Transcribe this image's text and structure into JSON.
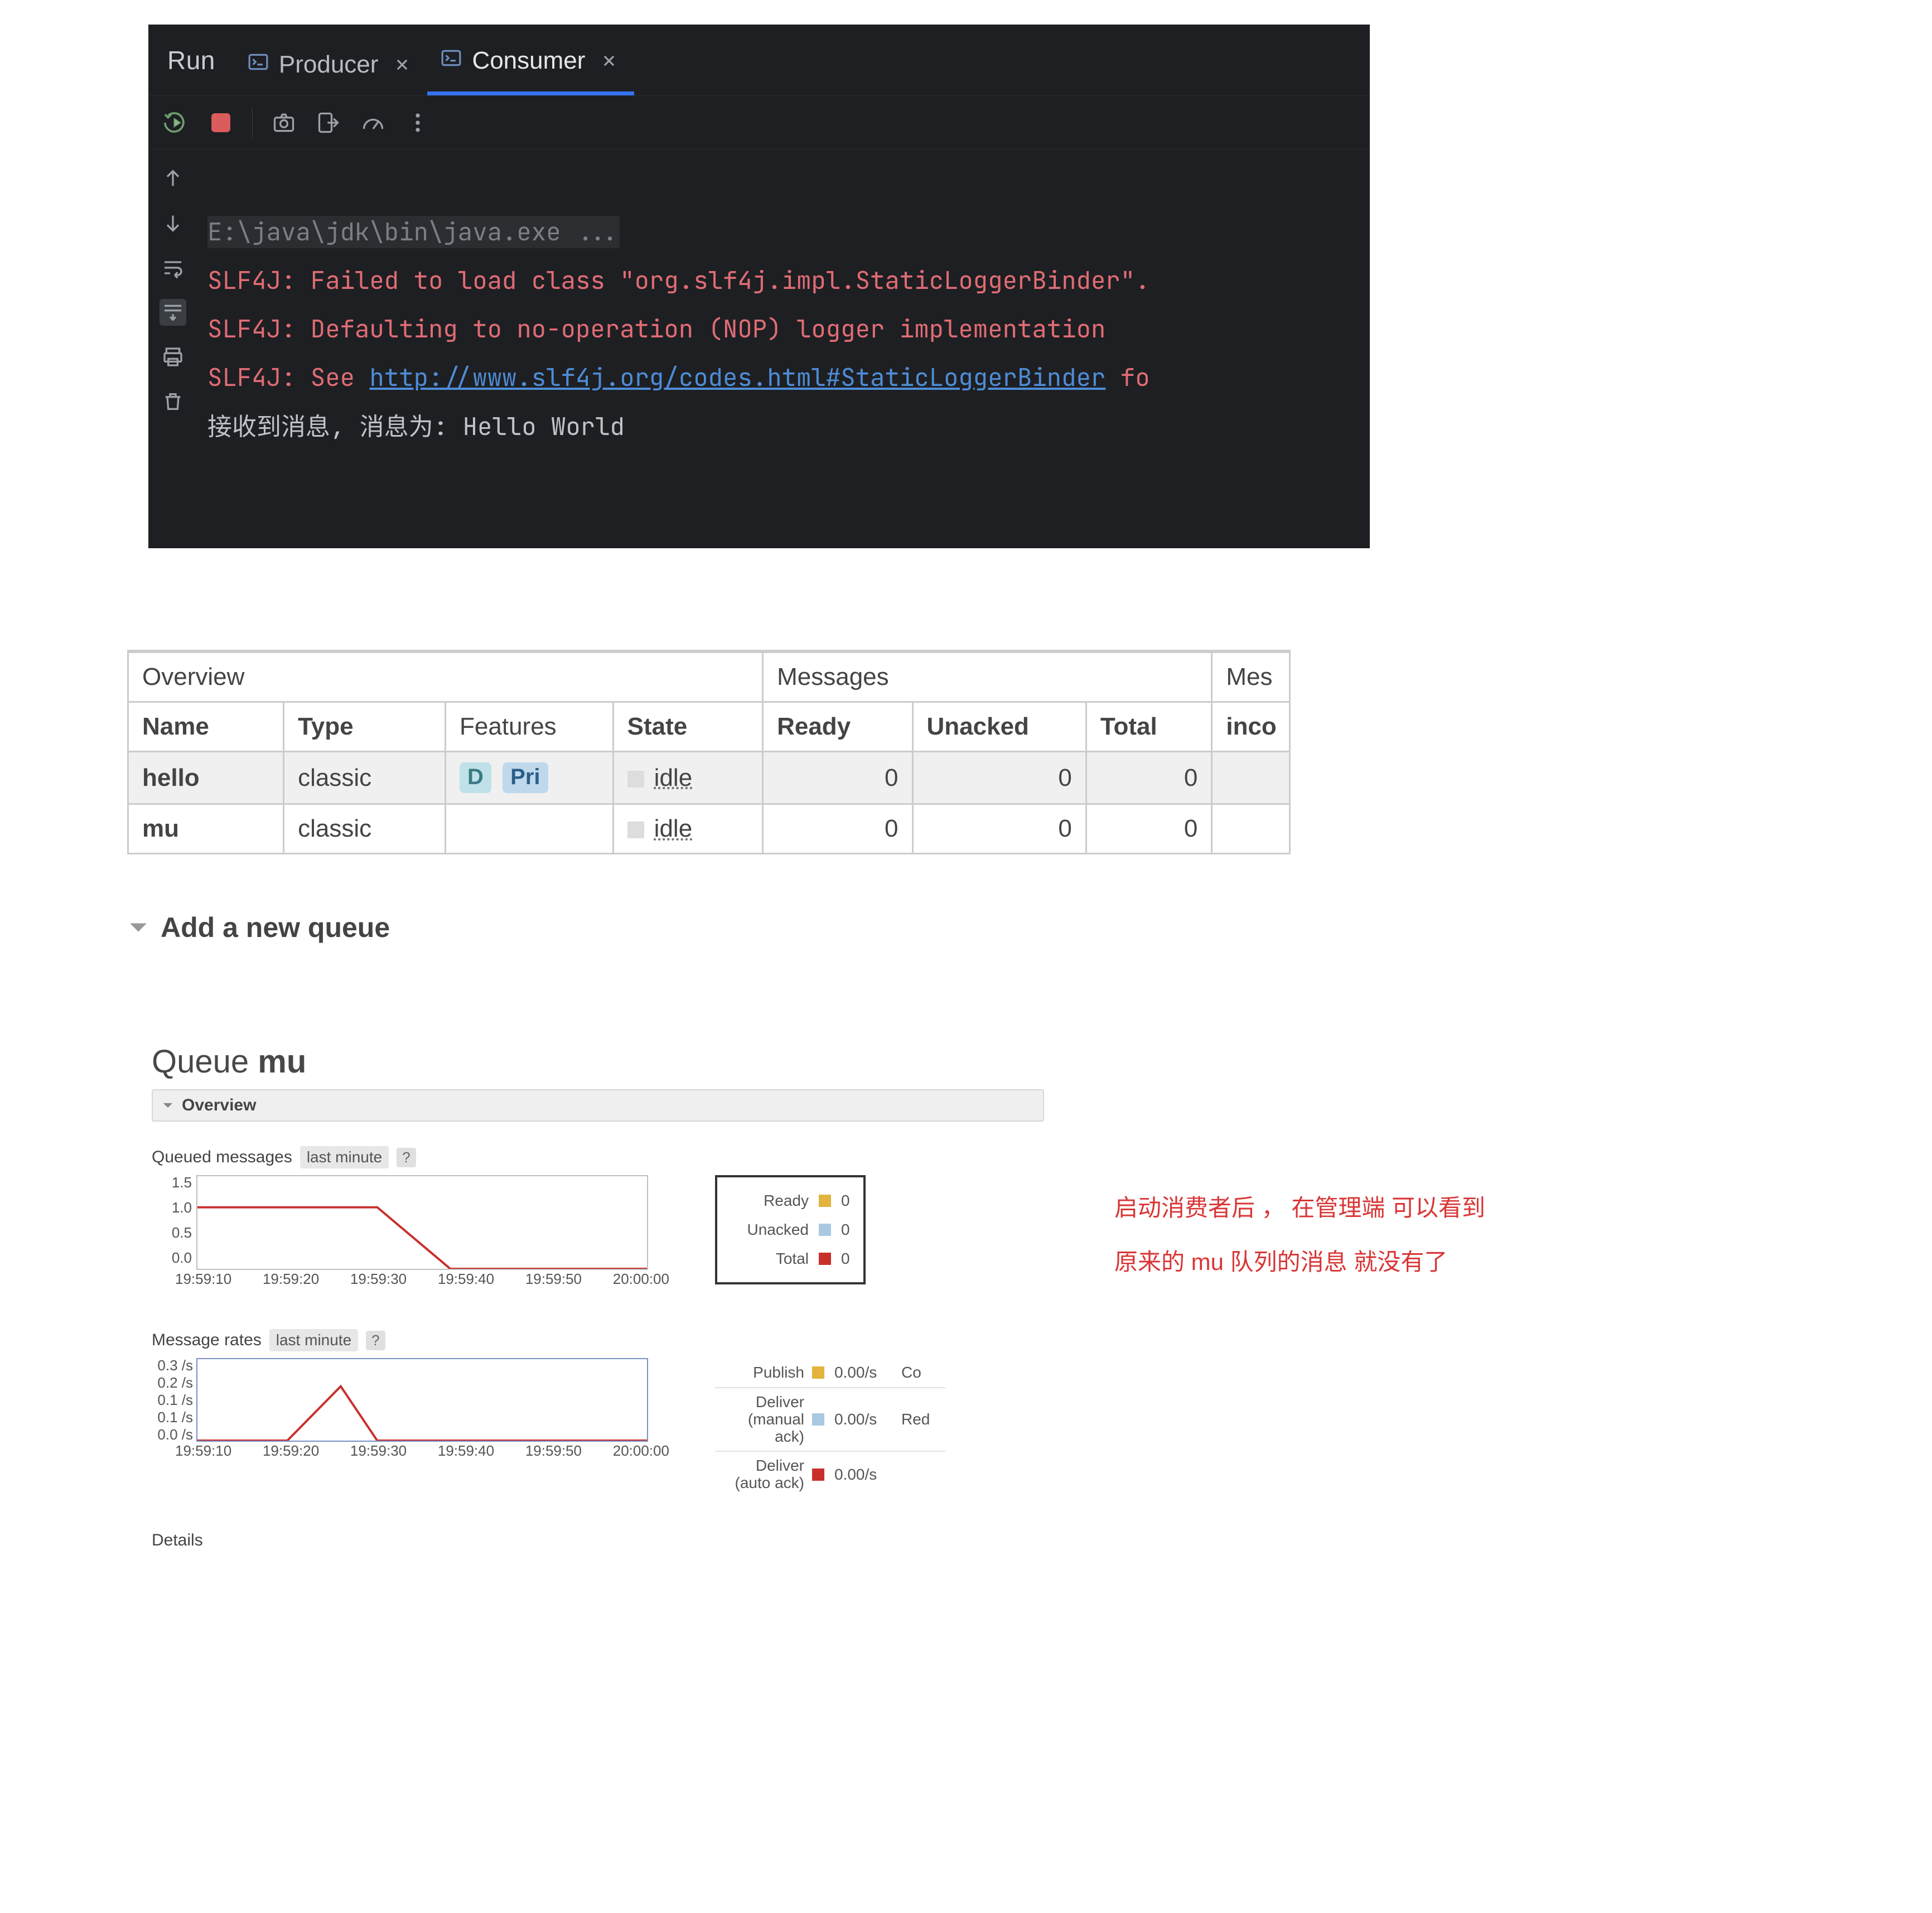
{
  "ide": {
    "runLabel": "Run",
    "tabs": [
      {
        "label": "Producer",
        "active": false
      },
      {
        "label": "Consumer",
        "active": true
      }
    ],
    "console": {
      "cmd": "E:\\java\\jdk\\bin\\java.exe ...",
      "warn1": "SLF4J: Failed to load class \"org.slf4j.impl.StaticLoggerBinder\".",
      "warn2": "SLF4J: Defaulting to no-operation (NOP) logger implementation",
      "warn3a": "SLF4J: See ",
      "warn3link": "http://www.slf4j.org/codes.html#StaticLoggerBinder",
      "warn3b": " fo",
      "msg": "接收到消息, 消息为: Hello World"
    }
  },
  "queues": {
    "headers": {
      "overview": "Overview",
      "messages": "Messages",
      "messagesTrunc": "Mes",
      "name": "Name",
      "type": "Type",
      "features": "Features",
      "state": "State",
      "ready": "Ready",
      "unacked": "Unacked",
      "total": "Total",
      "incoming": "inco"
    },
    "rows": [
      {
        "name": "hello",
        "type": "classic",
        "badgeD": "D",
        "badgePri": "Pri",
        "state": "idle",
        "ready": "0",
        "unacked": "0",
        "total": "0"
      },
      {
        "name": "mu",
        "type": "classic",
        "badgeD": "",
        "badgePri": "",
        "state": "idle",
        "ready": "0",
        "unacked": "0",
        "total": "0"
      }
    ],
    "addLabel": "Add a new queue"
  },
  "queueDetail": {
    "titlePrefix": "Queue ",
    "titleName": "mu",
    "overview": "Overview",
    "queuedMsgs": "Queued messages",
    "lastMinute": "last minute",
    "q": "?",
    "chart1": {
      "ylabels": [
        "1.5",
        "1.0",
        "0.5",
        "0.0"
      ],
      "xlabels": [
        "19:59:10",
        "19:59:20",
        "19:59:30",
        "19:59:40",
        "19:59:50",
        "20:00:00"
      ],
      "legend": [
        {
          "label": "Ready",
          "swatch": "sw-yellow",
          "val": "0"
        },
        {
          "label": "Unacked",
          "swatch": "sw-blue",
          "val": "0"
        },
        {
          "label": "Total",
          "swatch": "sw-red",
          "val": "0"
        }
      ]
    },
    "messageRates": "Message rates",
    "chart2": {
      "ylabels": [
        "0.3 /s",
        "0.2 /s",
        "0.1 /s",
        "0.1 /s",
        "0.0 /s"
      ],
      "xlabels": [
        "19:59:10",
        "19:59:20",
        "19:59:30",
        "19:59:40",
        "19:59:50",
        "20:00:00"
      ],
      "rates": [
        {
          "label": "Publish",
          "swatch": "sw-yellow",
          "val": "0.00/s",
          "extra": "Co"
        },
        {
          "label": "Deliver\n(manual\nack)",
          "swatch": "sw-blue",
          "val": "0.00/s",
          "extra": "Red"
        },
        {
          "label": "Deliver\n(auto ack)",
          "swatch": "sw-red",
          "val": "0.00/s",
          "extra": ""
        }
      ]
    },
    "details": "Details"
  },
  "annotation": {
    "line1": "启动消费者后 ， 在管理端 可以看到",
    "line2": "原来的 mu 队列的消息 就没有了"
  },
  "chart_data": [
    {
      "type": "line",
      "title": "Queued messages (last minute)",
      "x": [
        "19:59:10",
        "19:59:20",
        "19:59:30",
        "19:59:40",
        "19:59:50",
        "20:00:00"
      ],
      "series": [
        {
          "name": "Ready",
          "values": [
            1.0,
            1.0,
            1.0,
            0.0,
            0.0,
            0.0
          ]
        },
        {
          "name": "Unacked",
          "values": [
            0.0,
            0.0,
            0.0,
            0.0,
            0.0,
            0.0
          ]
        },
        {
          "name": "Total",
          "values": [
            1.0,
            1.0,
            1.0,
            0.0,
            0.0,
            0.0
          ]
        }
      ],
      "ylim": [
        0.0,
        1.5
      ]
    },
    {
      "type": "line",
      "title": "Message rates (last minute)",
      "x": [
        "19:59:10",
        "19:59:20",
        "19:59:30",
        "19:59:40",
        "19:59:50",
        "20:00:00"
      ],
      "series": [
        {
          "name": "Publish",
          "values": [
            0.0,
            0.0,
            0.0,
            0.0,
            0.0,
            0.0
          ]
        },
        {
          "name": "Deliver (manual ack)",
          "values": [
            0.0,
            0.0,
            0.0,
            0.0,
            0.0,
            0.0
          ]
        },
        {
          "name": "Deliver (auto ack)",
          "values": [
            0.0,
            0.0,
            0.2,
            0.0,
            0.0,
            0.0
          ]
        }
      ],
      "ylim": [
        0.0,
        0.3
      ],
      "yunit": "/s"
    }
  ]
}
